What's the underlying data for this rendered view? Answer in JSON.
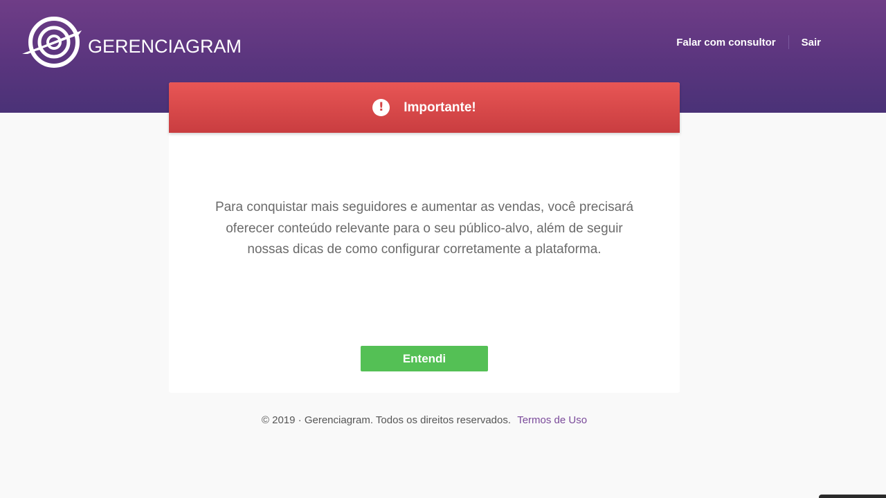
{
  "header": {
    "logo_text": "GERENCIAGRAM",
    "logo_icon": "gerenciagram-logo-icon",
    "nav": {
      "consultant_label": "Falar com consultor",
      "logout_label": "Sair"
    }
  },
  "alert": {
    "icon": "exclamation-circle-icon",
    "icon_glyph": "!",
    "title": "Importante!",
    "message": "Para conquistar mais seguidores e aumentar as vendas, você precisará oferecer conteúdo relevante para o seu público-alvo, além de seguir nossas dicas de como configurar corretamente a plataforma.",
    "button_label": "Entendi"
  },
  "footer": {
    "copyright": "© 2019 · Gerenciagram. Todos os direitos reservados.",
    "terms_label": "Termos de Uso"
  },
  "colors": {
    "header_gradient_top": "#6f3d87",
    "header_gradient_bottom": "#4a3277",
    "alert_red": "#e05050",
    "button_green": "#54c055",
    "link_purple": "#7a4a9a"
  }
}
